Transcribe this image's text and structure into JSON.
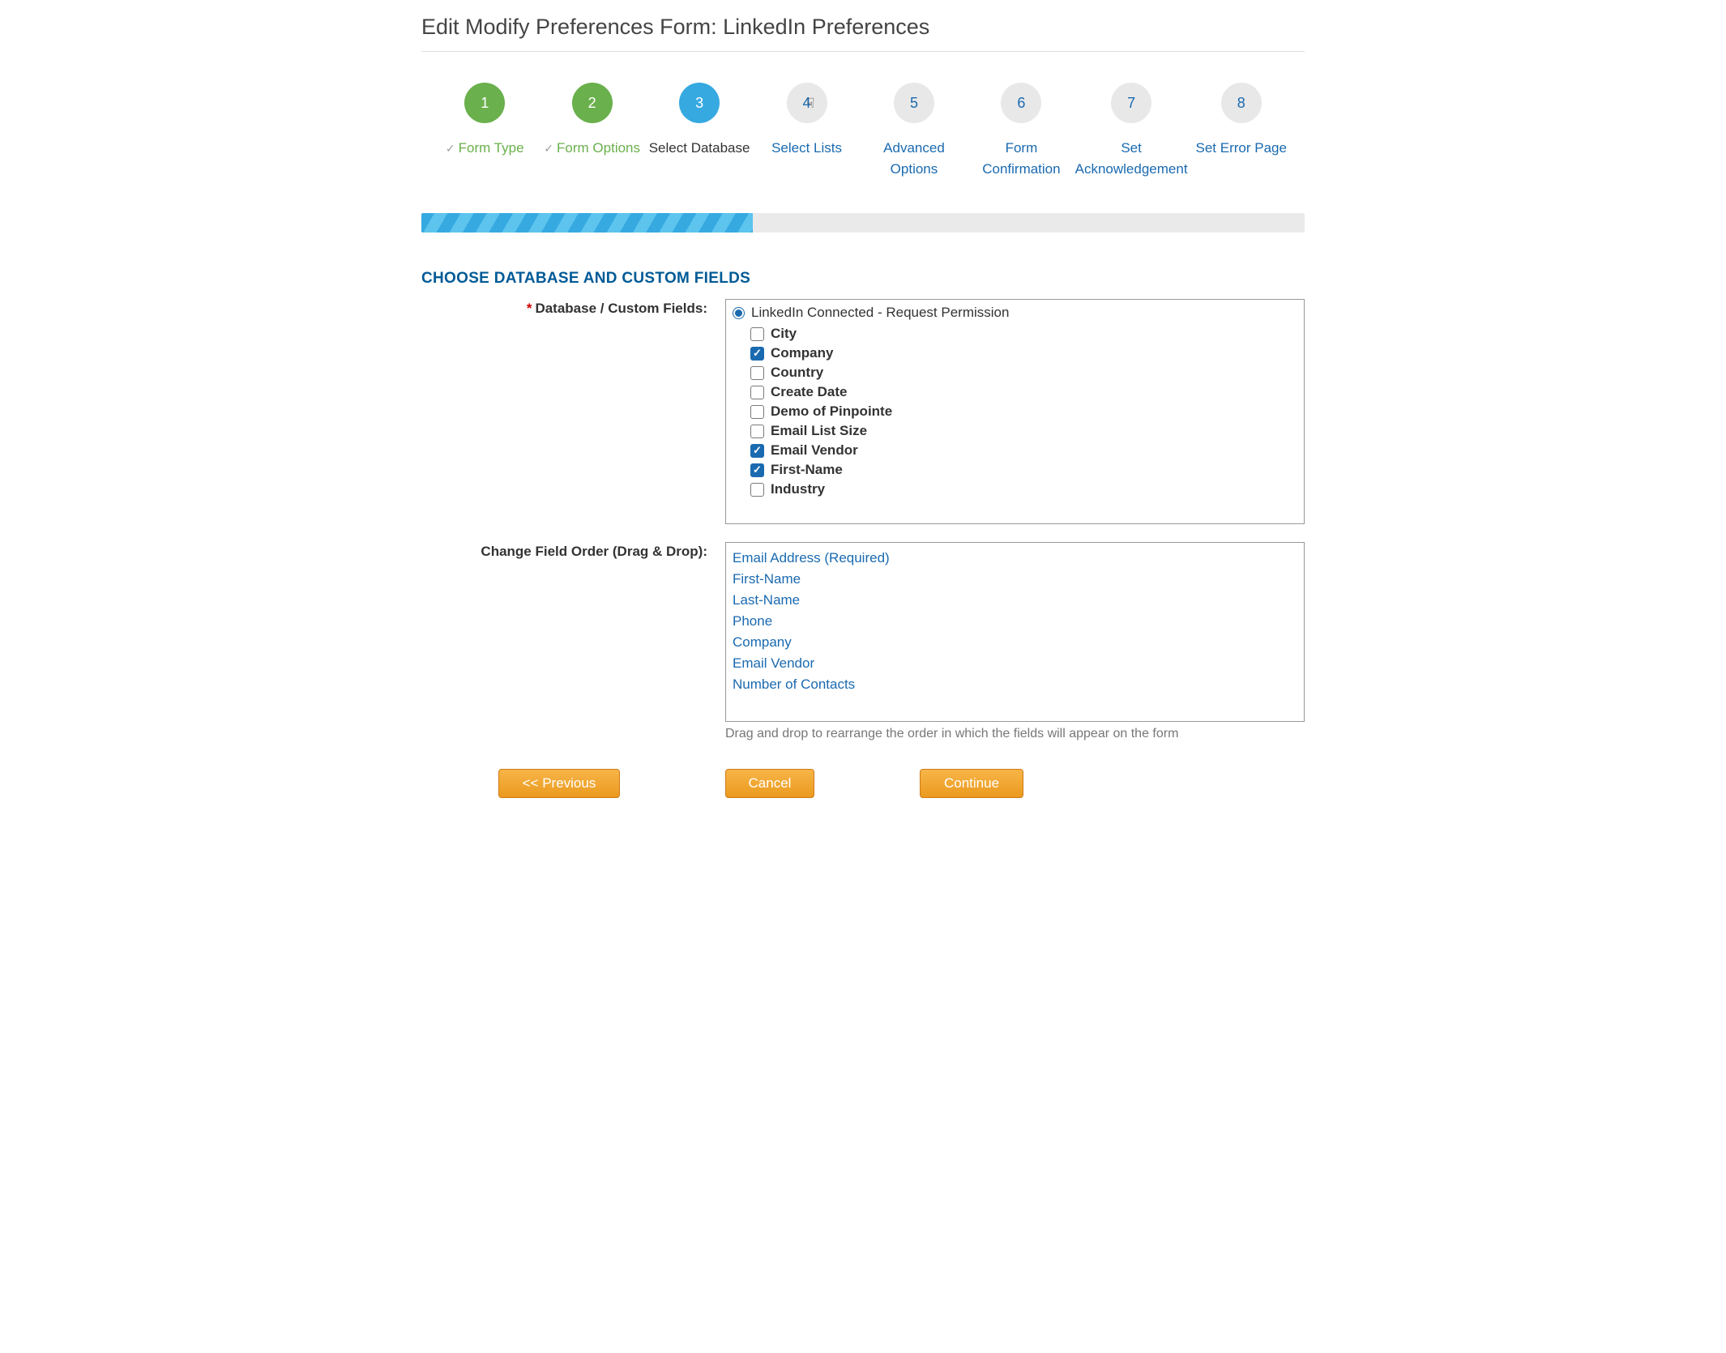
{
  "page": {
    "title": "Edit Modify Preferences Form: LinkedIn Preferences"
  },
  "steps": [
    {
      "num": "1",
      "label": "Form Type",
      "state": "completed"
    },
    {
      "num": "2",
      "label": "Form Options",
      "state": "completed"
    },
    {
      "num": "3",
      "label": "Select Database",
      "state": "current"
    },
    {
      "num": "4",
      "label": "Select Lists",
      "state": "pending"
    },
    {
      "num": "5",
      "label": "Advanced Options",
      "state": "pending"
    },
    {
      "num": "6",
      "label": "Form Confirmation",
      "state": "pending"
    },
    {
      "num": "7",
      "label": "Set Acknowledgement",
      "state": "pending"
    },
    {
      "num": "8",
      "label": "Set Error Page",
      "state": "pending"
    }
  ],
  "progress_percent": 37.5,
  "section": {
    "title": "Choose Database and Custom Fields",
    "db_label": "Database / Custom Fields:",
    "order_label": "Change Field Order (Drag & Drop):",
    "dd_hint": "Drag and drop to rearrange the order in which the fields will appear on the form"
  },
  "database": {
    "radio_label": "LinkedIn Connected - Request Permission",
    "fields": [
      {
        "name": "City",
        "checked": false
      },
      {
        "name": "Company",
        "checked": true
      },
      {
        "name": "Country",
        "checked": false
      },
      {
        "name": "Create Date",
        "checked": false
      },
      {
        "name": "Demo of Pinpointe",
        "checked": false
      },
      {
        "name": "Email List Size",
        "checked": false
      },
      {
        "name": "Email Vendor",
        "checked": true
      },
      {
        "name": "First-Name",
        "checked": true
      },
      {
        "name": "Industry",
        "checked": false
      }
    ]
  },
  "field_order": [
    "Email Address (Required)",
    "First-Name",
    "Last-Name",
    "Phone",
    "Company",
    "Email Vendor",
    "Number of Contacts"
  ],
  "buttons": {
    "previous": "<< Previous",
    "cancel": "Cancel",
    "continue": "Continue"
  }
}
